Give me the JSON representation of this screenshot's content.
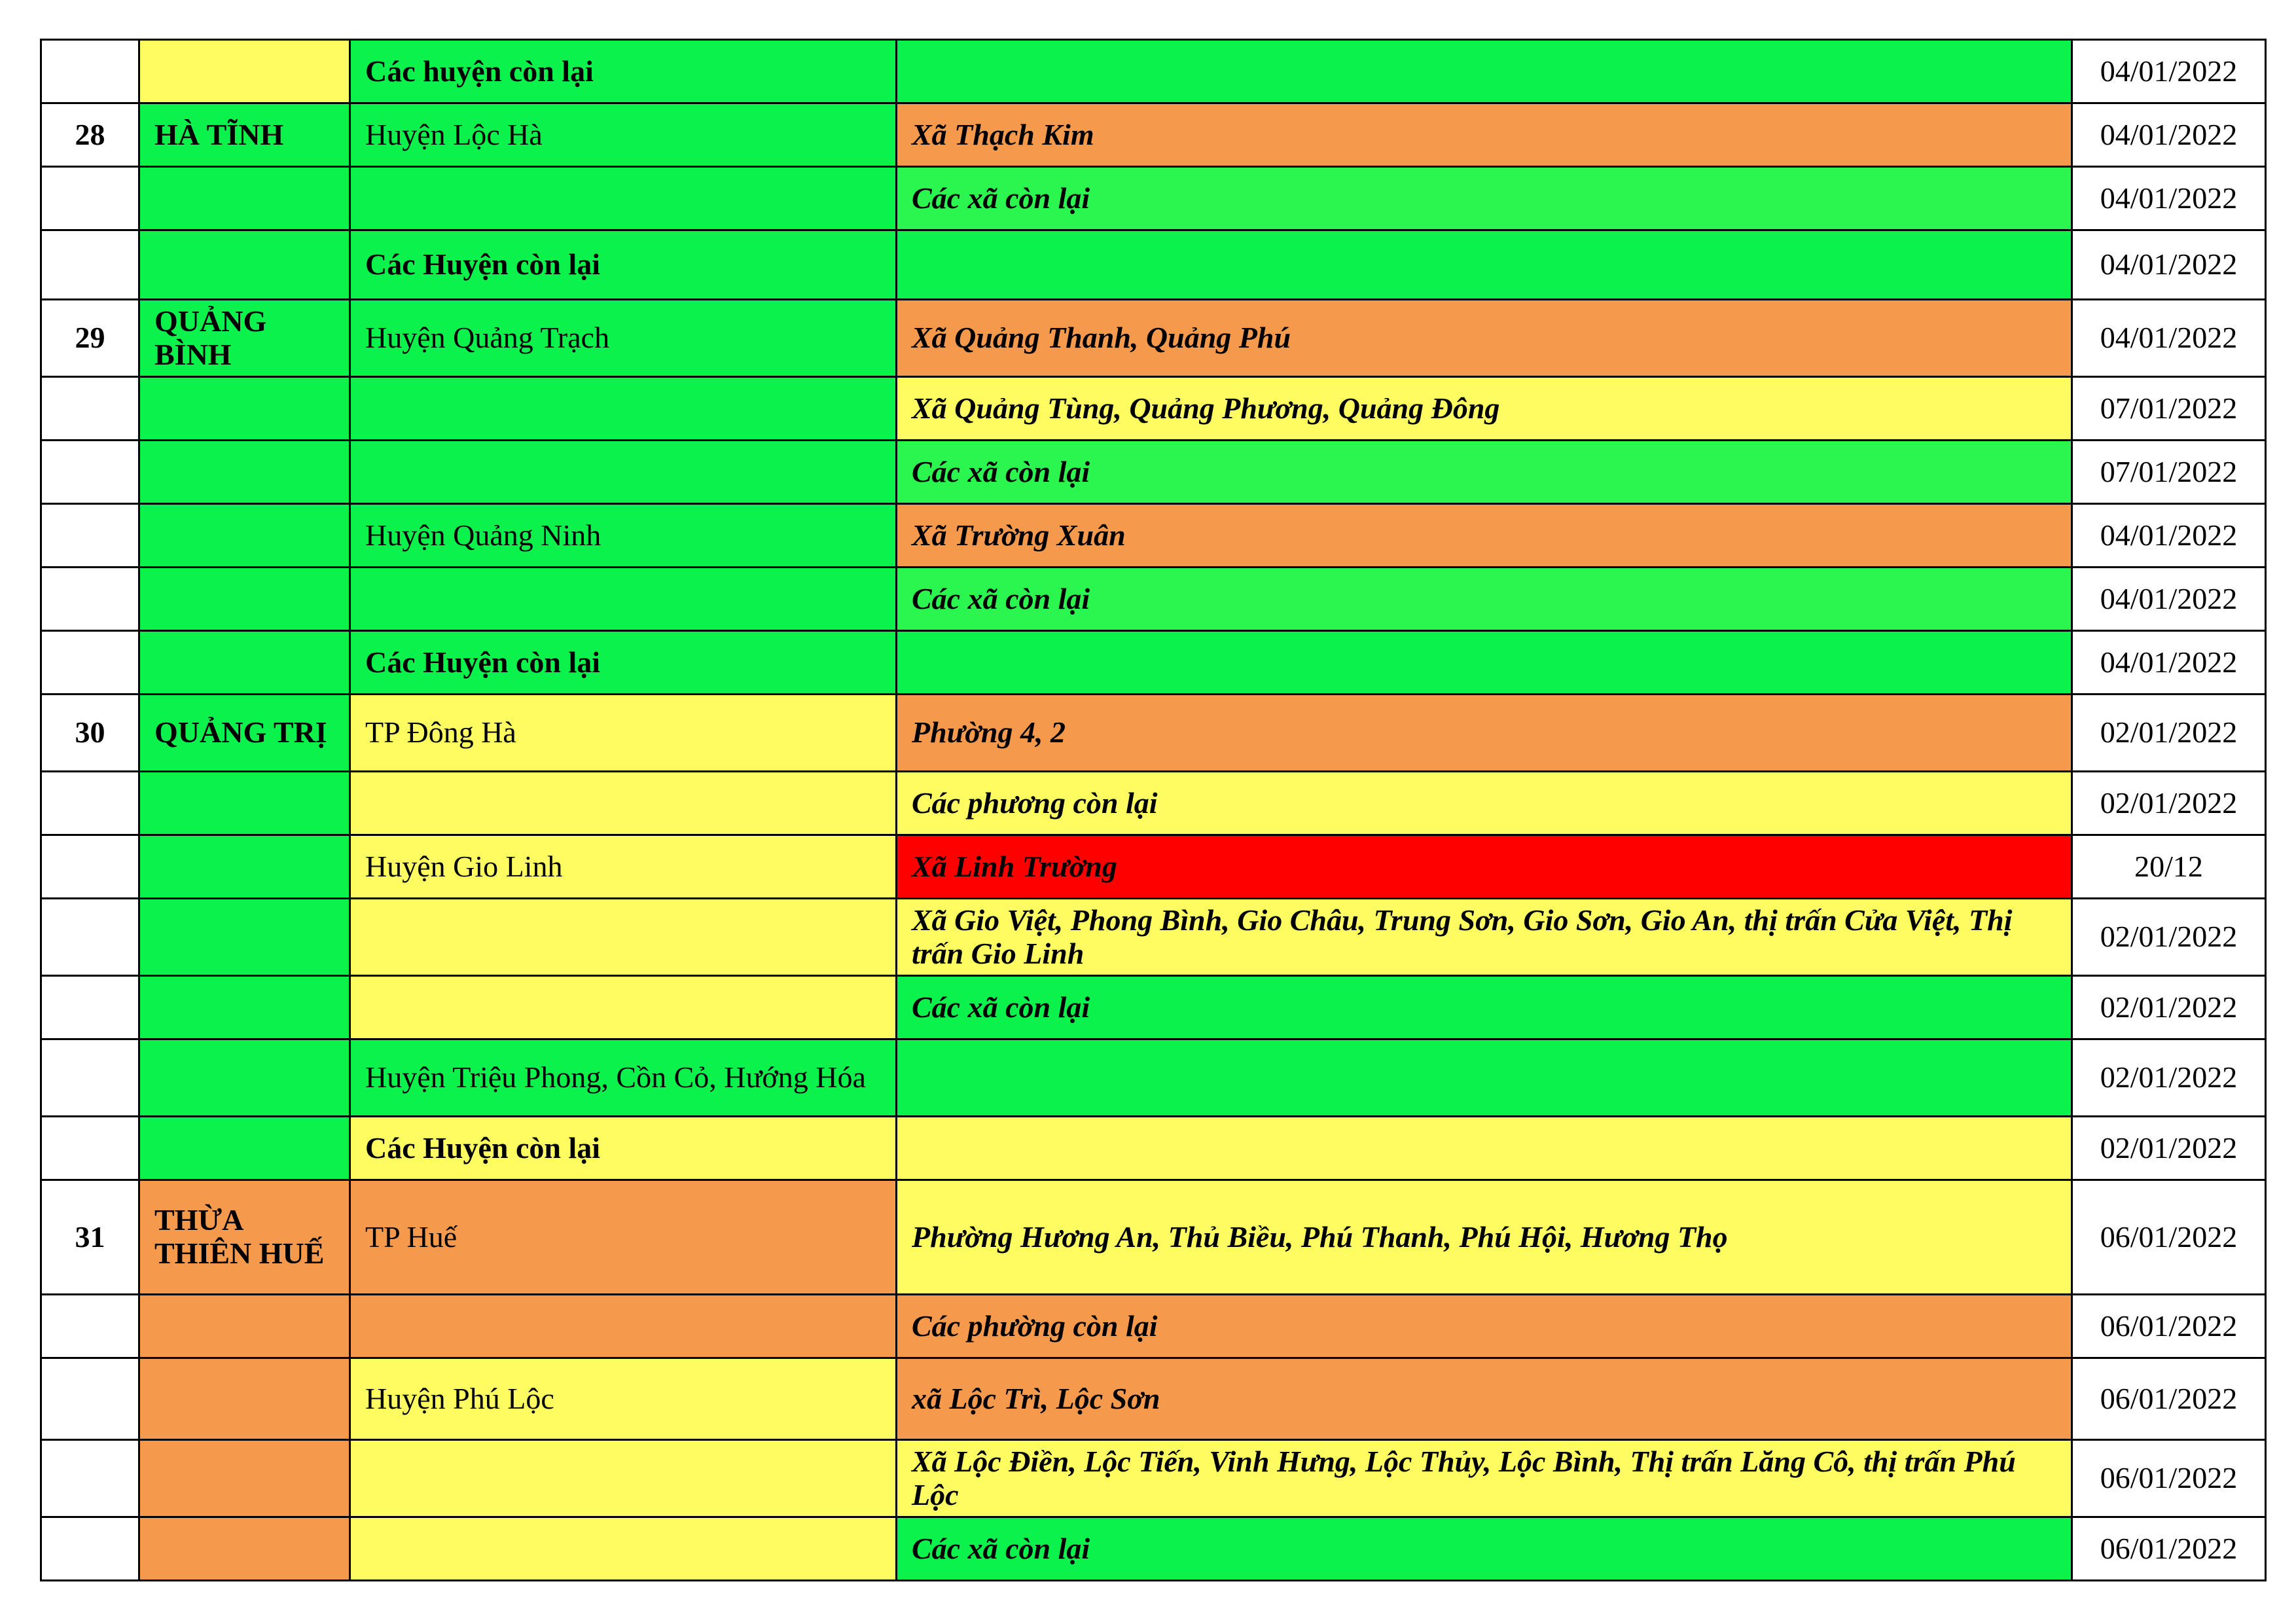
{
  "colors": {
    "green": "#0cf24c",
    "light_green": "#2bf54f",
    "yellow": "#fdfc61",
    "orange": "#f59a4c",
    "red": "#ff0000"
  },
  "rows": [
    {
      "stt": "",
      "province": "",
      "district": "Các huyện còn lại",
      "district_bold": true,
      "ward": "",
      "date": "04/01/2022",
      "c_prov": "yellow",
      "c_dist": "green",
      "c_ward": "green"
    },
    {
      "stt": "28",
      "province": "HÀ TĨNH",
      "district": "Huyện Lộc Hà",
      "district_bold": false,
      "ward": "Xã Thạch Kim",
      "date": "04/01/2022",
      "c_prov": "green",
      "c_dist": "green",
      "c_ward": "orange"
    },
    {
      "stt": "",
      "province": "",
      "district": "",
      "district_bold": false,
      "ward": "Các xã còn lại",
      "date": "04/01/2022",
      "c_prov": "green",
      "c_dist": "green",
      "c_ward": "light_green"
    },
    {
      "stt": "",
      "province": "",
      "district": "Các Huyện còn lại",
      "district_bold": true,
      "ward": "",
      "date": "04/01/2022",
      "c_prov": "green",
      "c_dist": "green",
      "c_ward": "green"
    },
    {
      "stt": "29",
      "province": "QUẢNG BÌNH",
      "district": "Huyện Quảng Trạch",
      "district_bold": false,
      "ward": "Xã Quảng Thanh, Quảng Phú",
      "date": "04/01/2022",
      "c_prov": "green",
      "c_dist": "green",
      "c_ward": "orange"
    },
    {
      "stt": "",
      "province": "",
      "district": "",
      "district_bold": false,
      "ward": "Xã Quảng Tùng, Quảng Phương, Quảng Đông",
      "date": "07/01/2022",
      "c_prov": "green",
      "c_dist": "green",
      "c_ward": "yellow"
    },
    {
      "stt": "",
      "province": "",
      "district": "",
      "district_bold": false,
      "ward": "Các xã còn lại",
      "date": "07/01/2022",
      "c_prov": "green",
      "c_dist": "green",
      "c_ward": "light_green"
    },
    {
      "stt": "",
      "province": "",
      "district": "Huyện Quảng Ninh",
      "district_bold": false,
      "ward": "Xã Trường Xuân",
      "date": "04/01/2022",
      "c_prov": "green",
      "c_dist": "green",
      "c_ward": "orange"
    },
    {
      "stt": "",
      "province": "",
      "district": "",
      "district_bold": false,
      "ward": "Các xã còn lại",
      "date": "04/01/2022",
      "c_prov": "green",
      "c_dist": "green",
      "c_ward": "light_green"
    },
    {
      "stt": "",
      "province": "",
      "district": "Các Huyện còn lại",
      "district_bold": true,
      "ward": "",
      "date": "04/01/2022",
      "c_prov": "green",
      "c_dist": "green",
      "c_ward": "green"
    },
    {
      "stt": "30",
      "province": "QUẢNG TRỊ",
      "district": "TP Đông Hà",
      "district_bold": false,
      "ward": "Phường 4, 2",
      "date": "02/01/2022",
      "c_prov": "green",
      "c_dist": "yellow",
      "c_ward": "orange"
    },
    {
      "stt": "",
      "province": "",
      "district": "",
      "district_bold": false,
      "ward": "Các phương còn lại",
      "date": "02/01/2022",
      "c_prov": "green",
      "c_dist": "yellow",
      "c_ward": "yellow"
    },
    {
      "stt": "",
      "province": "",
      "district": "Huyện Gio Linh",
      "district_bold": false,
      "ward": "Xã Linh Trường",
      "date": "20/12",
      "c_prov": "green",
      "c_dist": "yellow",
      "c_ward": "red"
    },
    {
      "stt": "",
      "province": "",
      "district": "",
      "district_bold": false,
      "ward": "Xã Gio Việt, Phong Bình, Gio Châu, Trung Sơn, Gio Sơn, Gio An, thị trấn Cửa Việt, Thị trấn Gio Linh",
      "date": "02/01/2022",
      "c_prov": "green",
      "c_dist": "yellow",
      "c_ward": "yellow"
    },
    {
      "stt": "",
      "province": "",
      "district": "",
      "district_bold": false,
      "ward": "Các xã còn lại",
      "date": "02/01/2022",
      "c_prov": "green",
      "c_dist": "yellow",
      "c_ward": "green"
    },
    {
      "stt": "",
      "province": "",
      "district": "Huyện Triệu Phong, Cồn Cỏ, Hướng Hóa",
      "district_bold": false,
      "ward": "",
      "date": "02/01/2022",
      "c_prov": "green",
      "c_dist": "green",
      "c_ward": "green"
    },
    {
      "stt": "",
      "province": "",
      "district": "Các Huyện còn lại",
      "district_bold": true,
      "ward": "",
      "date": "02/01/2022",
      "c_prov": "green",
      "c_dist": "yellow",
      "c_ward": "yellow"
    },
    {
      "stt": "31",
      "province": "THỪA THIÊN HUẾ",
      "district": "TP Huế",
      "district_bold": false,
      "ward": "Phường Hương An, Thủ Biều, Phú Thanh, Phú Hội, Hương Thọ",
      "date": "06/01/2022",
      "c_prov": "orange",
      "c_dist": "orange",
      "c_ward": "yellow"
    },
    {
      "stt": "",
      "province": "",
      "district": "",
      "district_bold": false,
      "ward": "Các phường còn lại",
      "date": "06/01/2022",
      "c_prov": "orange",
      "c_dist": "orange",
      "c_ward": "orange"
    },
    {
      "stt": "",
      "province": "",
      "district": "Huyện Phú Lộc",
      "district_bold": false,
      "ward": "xã Lộc Trì, Lộc Sơn",
      "date": "06/01/2022",
      "c_prov": "orange",
      "c_dist": "yellow",
      "c_ward": "orange"
    },
    {
      "stt": "",
      "province": "",
      "district": "",
      "district_bold": false,
      "ward": "Xã Lộc Điền, Lộc Tiến, Vinh Hưng, Lộc Thủy, Lộc Bình, Thị trấn Lăng Cô, thị trấn Phú Lộc",
      "date": "06/01/2022",
      "c_prov": "orange",
      "c_dist": "yellow",
      "c_ward": "yellow"
    },
    {
      "stt": "",
      "province": "",
      "district": "",
      "district_bold": false,
      "ward": "Các xã còn lại",
      "date": "06/01/2022",
      "c_prov": "orange",
      "c_dist": "yellow",
      "c_ward": "green"
    }
  ]
}
